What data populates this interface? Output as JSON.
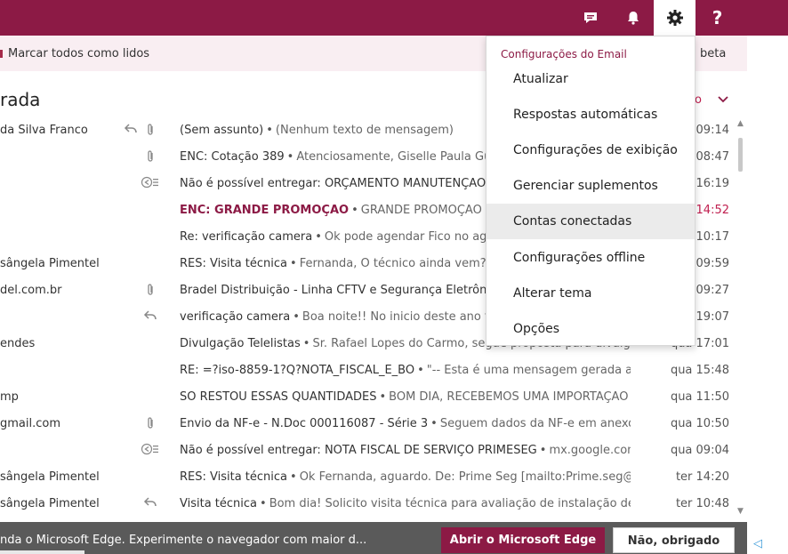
{
  "colors": {
    "brand": "#8c1a45",
    "highlight": "#c02050"
  },
  "topbar": {
    "buttons": [
      {
        "name": "chat-button",
        "icon": "chat-icon"
      },
      {
        "name": "notifications-button",
        "icon": "bell-icon"
      },
      {
        "name": "settings-button",
        "icon": "gear-icon",
        "active": true
      },
      {
        "name": "help-button",
        "icon": "question-icon",
        "label": "?"
      }
    ]
  },
  "actionbar": {
    "mark_all_read": "Marcar todos como lidos",
    "beta": "beta"
  },
  "folder": {
    "title": "rada",
    "filter_label": "o"
  },
  "mails": [
    {
      "sender": "da Silva Franco",
      "icons": [
        "reply-icon",
        "paperclip-icon"
      ],
      "subject": "(Sem assunto)",
      "preview": "(Nenhum texto de mensagem)",
      "date": "09:14"
    },
    {
      "sender": "",
      "icons": [
        "",
        "paperclip-icon"
      ],
      "subject": "ENC: Cotação 389",
      "preview": "Atenciosamente,  Giselle Paula Guim",
      "date": "08:47"
    },
    {
      "sender": "",
      "icons": [
        "",
        "undeliverable-icon"
      ],
      "subject": "Não é possível entregar: ORÇAMENTO MANUTENÇÃO D",
      "preview": "",
      "date": "i 16:19"
    },
    {
      "sender": "",
      "icons": [
        "",
        ""
      ],
      "subject": "ENC: GRANDE PROMOÇAO",
      "preview": "GRANDE PROMOÇAO   A",
      "date": "i 14:52",
      "highlight": true
    },
    {
      "sender": "",
      "icons": [
        "",
        ""
      ],
      "subject": "Re: verificação camera",
      "preview": "Ok pode agendar  Fico no agua",
      "date": "i 10:17"
    },
    {
      "sender": "sângela Pimentel",
      "icons": [
        "",
        ""
      ],
      "subject": "RES: Visita técnica",
      "preview": "Fernanda,  O técnico ainda vem?  At",
      "date": "09:59"
    },
    {
      "sender": "del.com.br",
      "icons": [
        "",
        "paperclip-icon"
      ],
      "subject": "Bradel Distribuição - Linha CFTV e Segurança Eletrônica",
      "preview": "",
      "date": "09:27"
    },
    {
      "sender": "",
      "icons": [
        "",
        "reply-icon"
      ],
      "subject": "verificação camera",
      "preview": "Boa noite!!  No inicio deste ano fizem",
      "date": "a 19:07"
    },
    {
      "sender": "endes",
      "icons": [
        "",
        ""
      ],
      "subject": "Divulgação Telelistas",
      "preview": "Sr. Rafael Lopes do Carmo, segue proposta para divulgação",
      "date": "qua 17:01"
    },
    {
      "sender": "",
      "icons": [
        "",
        ""
      ],
      "subject": "RE: =?iso-8859-1?Q?NOTA_FISCAL_E_BO",
      "preview": "\"-- Esta é uma mensagem gerada auto",
      "date": "qua 15:48"
    },
    {
      "sender": "mp",
      "icons": [
        "",
        ""
      ],
      "subject": "SÓ RESTOU ESSAS QUANTIDADES",
      "preview": "BOM DIA,  RECEBEMOS UMA IMPORTAÇÃO D",
      "date": "qua 11:50"
    },
    {
      "sender": "gmail.com",
      "icons": [
        "",
        "paperclip-icon"
      ],
      "subject": "Envio da NF-e - N.Doc 000116087 - Série 3",
      "preview": "Seguem dados da NF-e em anexo.",
      "date": "qua 10:50"
    },
    {
      "sender": "",
      "icons": [
        "",
        "undeliverable-icon"
      ],
      "subject": "Não é possível entregar: NOTA FISCAL DE SERVIÇO PRIMESEG",
      "preview": "mx.google.com r",
      "date": "qua 09:04"
    },
    {
      "sender": "sângela Pimentel",
      "icons": [
        "",
        ""
      ],
      "subject": "RES: Visita técnica",
      "preview": "Ok Fernanda, aguardo.  De: Prime Seg [mailto:Prime.seg@hotm",
      "date": "ter 14:20"
    },
    {
      "sender": "sângela Pimentel",
      "icons": [
        "",
        "reply-icon"
      ],
      "subject": "Visita técnica",
      "preview": "Bom dia!  Solicito visita técnica para avaliação de instalação de Sinale",
      "date": "ter 10:48"
    }
  ],
  "settings_menu": {
    "heading": "Configurações do Email",
    "items": [
      {
        "label": "Atualizar"
      },
      {
        "label": "Respostas automáticas"
      },
      {
        "label": "Configurações de exibição"
      },
      {
        "label": "Gerenciar suplementos"
      },
      {
        "label": "Contas conectadas",
        "hover": true
      },
      {
        "label": "Configurações offline"
      },
      {
        "label": "Alterar tema"
      },
      {
        "label": "Opções"
      }
    ]
  },
  "edge_banner": {
    "text": "nda o Microsoft Edge. Experimente o navegador com maior d...",
    "open_button": "Abrir o Microsoft Edge",
    "dismiss_button": "Não, obrigado"
  }
}
